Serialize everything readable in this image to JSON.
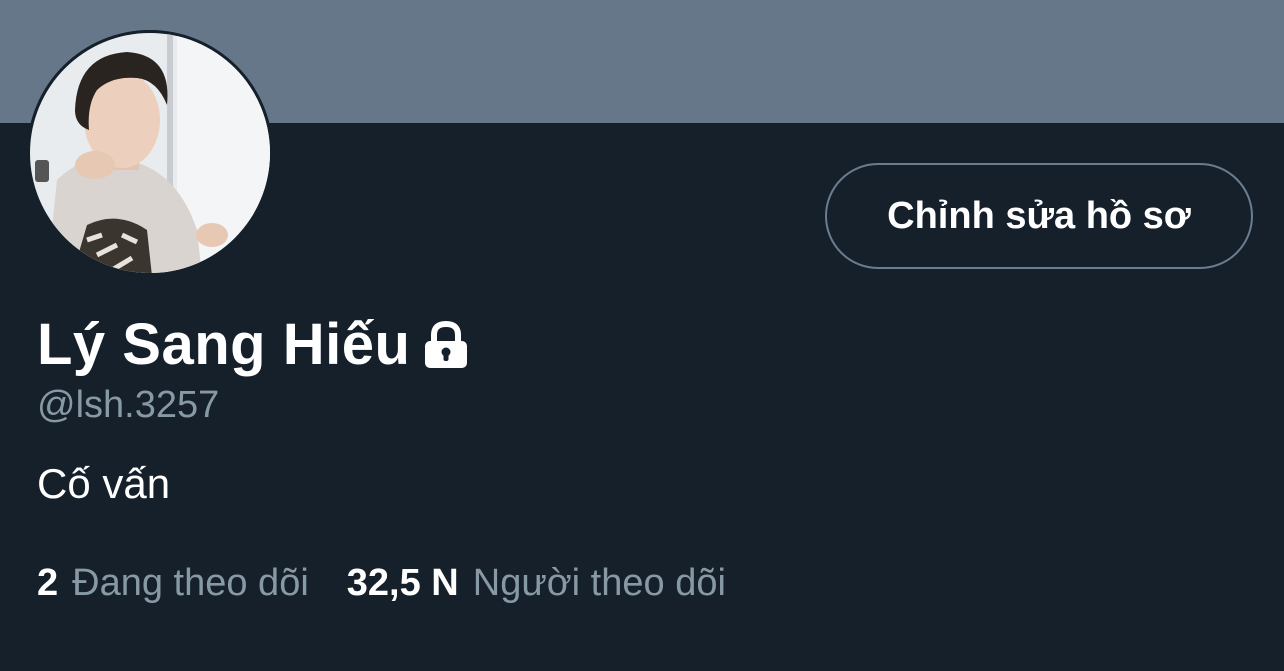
{
  "profile": {
    "display_name": "Lý Sang Hiếu",
    "handle": "@lsh.3257",
    "bio": "Cố vấn",
    "edit_profile_label": "Chỉnh sửa hồ sơ",
    "protected_icon": "lock-icon",
    "avatar_icon": "profile-photo"
  },
  "stats": [
    {
      "value": "2",
      "label": "Đang theo dõi"
    },
    {
      "value": "32,5 N",
      "label": "Người theo dõi"
    }
  ],
  "colors": {
    "background": "#15202b",
    "banner": "#66778a",
    "primary_text": "#ffffff",
    "secondary_text": "#8899a6",
    "button_border": "#6b7c8f"
  }
}
